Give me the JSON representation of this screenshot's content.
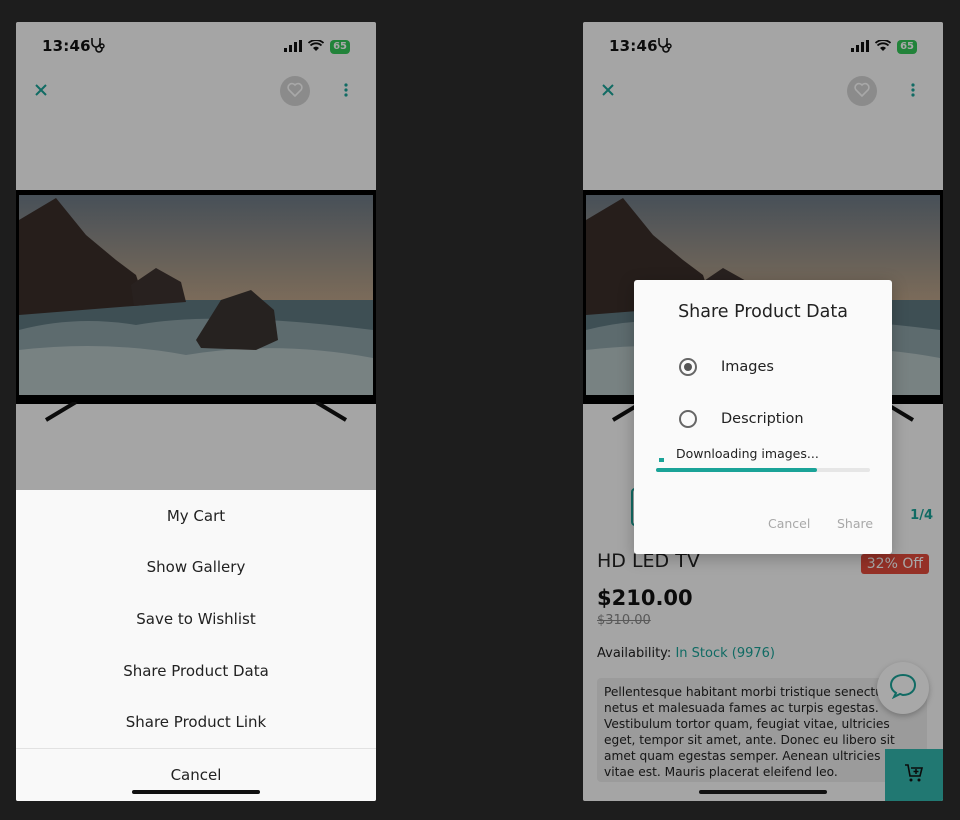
{
  "status": {
    "time": "13:46",
    "battery": "65"
  },
  "left": {
    "sheet_items": [
      "My Cart",
      "Show Gallery",
      "Save to Wishlist",
      "Share Product Data",
      "Share Product Link"
    ],
    "cancel_label": "Cancel"
  },
  "right": {
    "product": {
      "name": "HD LED TV",
      "discount": "32% Off",
      "price": "$210.00",
      "old_price": "$310.00",
      "availability_label": "Availability:",
      "stock": "In Stock (9976)",
      "description": "Pellentesque habitant morbi tristique senectus et netus et malesuada fames ac turpis egestas. Vestibulum tortor quam, feugiat vitae, ultricies eget, tempor sit amet, ante. Donec eu libero sit amet quam egestas semper. Aenean ultricies mi vitae est. Mauris placerat eleifend leo.",
      "page_counter": "1/4"
    },
    "dialog": {
      "title": "Share Product Data",
      "options": [
        {
          "label": "Images",
          "selected": true
        },
        {
          "label": "Description",
          "selected": false
        }
      ],
      "progress_label": "Downloading images...",
      "progress": 0.75,
      "cancel_label": "Cancel",
      "share_label": "Share"
    }
  },
  "colors": {
    "accent": "#1aa398",
    "discount": "#e24b3c",
    "cart_button": "#32b6ad"
  }
}
